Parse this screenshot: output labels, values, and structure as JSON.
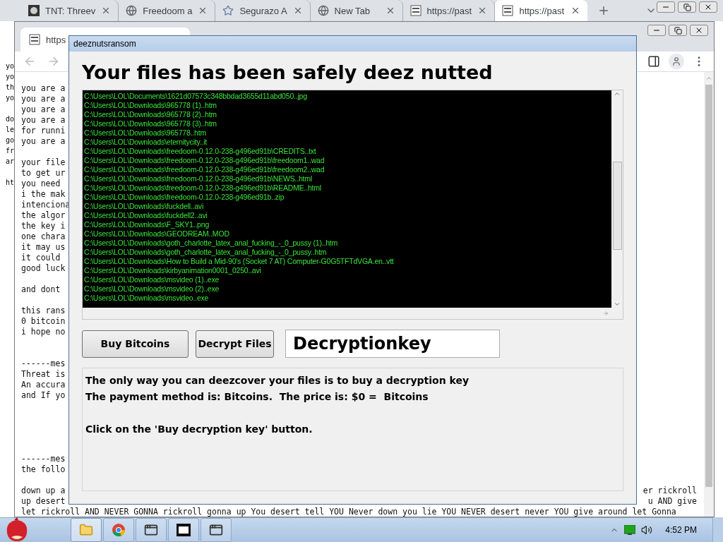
{
  "back_browser": {
    "tabs": [
      {
        "title": "TNT: Threev",
        "selected": false
      },
      {
        "title": "Freedoom a",
        "selected": false
      },
      {
        "title": "Segurazo A",
        "selected": false
      },
      {
        "title": "New Tab",
        "selected": false
      },
      {
        "title": "https://past",
        "selected": false
      },
      {
        "title": "https://past",
        "selected": true
      }
    ],
    "page_lines": [
      {
        "kind": "text",
        "text": "yo"
      },
      {
        "kind": "text",
        "text": "yo"
      },
      {
        "kind": "text",
        "text": "th"
      },
      {
        "kind": "text",
        "text": "yo"
      },
      {
        "kind": "blank"
      },
      {
        "kind": "text",
        "text": "do"
      },
      {
        "kind": "text",
        "text": "le"
      },
      {
        "kind": "text",
        "text": "go"
      },
      {
        "kind": "text",
        "text": "fr"
      },
      {
        "kind": "text",
        "text": "ar"
      },
      {
        "kind": "blank"
      },
      {
        "kind": "text",
        "text": "ht"
      }
    ]
  },
  "front_browser": {
    "tab": {
      "title": "https",
      "selected": true
    },
    "page_lines": [
      {
        "kind": "text",
        "text": "you are a"
      },
      {
        "kind": "text",
        "text": "you are a"
      },
      {
        "kind": "text",
        "text": "you are a"
      },
      {
        "kind": "text",
        "text": "you are a"
      },
      {
        "kind": "text",
        "text": "for runni"
      },
      {
        "kind": "text",
        "text": "you are a"
      },
      {
        "kind": "blank"
      },
      {
        "kind": "text",
        "text": "your file"
      },
      {
        "kind": "text",
        "text": "to get ur"
      },
      {
        "kind": "text",
        "text": "you need"
      },
      {
        "kind": "text",
        "text": "i the mak"
      },
      {
        "kind": "text",
        "text": "intenciona"
      },
      {
        "kind": "text",
        "text": "the algor"
      },
      {
        "kind": "text",
        "text": "the key i"
      },
      {
        "kind": "text",
        "text": "one chara"
      },
      {
        "kind": "text",
        "text": "it may us"
      },
      {
        "kind": "text",
        "text": "it could"
      },
      {
        "kind": "text",
        "text": "good luck"
      },
      {
        "kind": "blank"
      },
      {
        "kind": "text",
        "text": "and dont"
      },
      {
        "kind": "blank"
      },
      {
        "kind": "text",
        "text": "this rans"
      },
      {
        "kind": "text",
        "text": "0 bitcoin"
      },
      {
        "kind": "text",
        "text": "i hope no"
      },
      {
        "kind": "blank"
      },
      {
        "kind": "blank"
      },
      {
        "kind": "text",
        "text": "------mes"
      },
      {
        "kind": "text",
        "text": "Threat is"
      },
      {
        "kind": "text",
        "text": "An accura"
      },
      {
        "kind": "text",
        "text": "and If yo"
      },
      {
        "kind": "blank"
      },
      {
        "kind": "blank"
      },
      {
        "kind": "blank"
      },
      {
        "kind": "blank"
      },
      {
        "kind": "blank"
      },
      {
        "kind": "text",
        "text": "------mes"
      },
      {
        "kind": "text",
        "text": "the follo"
      },
      {
        "kind": "blank"
      },
      {
        "kind": "text",
        "text": "down up a",
        "tail": "er rickroll"
      },
      {
        "kind": "text",
        "text": "up desert",
        "tail": "u AND give"
      },
      {
        "kind": "text",
        "text": "let rickroll AND NEVER GONNA rickroll gonna up You desert tell YOU Never down you lie YOU NEVER desert never YOU give around let Gonna"
      }
    ]
  },
  "dialog": {
    "title": "deeznutsransom",
    "heading": "Your files has been safely deez nutted",
    "files": [
      "C:\\Users\\LOL\\Documents\\1621d07573c348bbdad3655d11abd050..jpg",
      "C:\\Users\\LOL\\Downloads\\965778 (1)..htm",
      "C:\\Users\\LOL\\Downloads\\965778 (2)..htm",
      "C:\\Users\\LOL\\Downloads\\965778 (3)..htm",
      "C:\\Users\\LOL\\Downloads\\965778..htm",
      "C:\\Users\\LOL\\Downloads\\eternitycity..it",
      "C:\\Users\\LOL\\Downloads\\freedoom-0.12.0-238-g496ed91b\\CREDITS..txt",
      "C:\\Users\\LOL\\Downloads\\freedoom-0.12.0-238-g496ed91b\\freedoom1..wad",
      "C:\\Users\\LOL\\Downloads\\freedoom-0.12.0-238-g496ed91b\\freedoom2..wad",
      "C:\\Users\\LOL\\Downloads\\freedoom-0.12.0-238-g496ed91b\\NEWS..html",
      "C:\\Users\\LOL\\Downloads\\freedoom-0.12.0-238-g496ed91b\\README..html",
      "C:\\Users\\LOL\\Downloads\\freedoom-0.12.0-238-g496ed91b..zip",
      "C:\\Users\\LOL\\Downloads\\fuckdell..avi",
      "C:\\Users\\LOL\\Downloads\\fuckdell2..avi",
      "C:\\Users\\LOL\\Downloads\\F_SKY1..png",
      "C:\\Users\\LOL\\Downloads\\GEODREAM..MOD",
      "C:\\Users\\LOL\\Downloads\\goth_charlotte_latex_anal_fucking_-_0_pussy (1)..htm",
      "C:\\Users\\LOL\\Downloads\\goth_charlotte_latex_anal_fucking_-_0_pussy..htm",
      "C:\\Users\\LOL\\Downloads\\How to Build a Mid-90's (Socket 7 AT) Computer-G0G5TFTdVGA.en..vtt",
      "C:\\Users\\LOL\\Downloads\\kirbyanimation0001_0250..avi",
      "C:\\Users\\LOL\\Downloads\\msvideo (1)..exe",
      "C:\\Users\\LOL\\Downloads\\msvideo (2)..exe",
      "C:\\Users\\LOL\\Downloads\\msvideo..exe"
    ],
    "buttons": [
      "Buy Bitcoins",
      "Decrypt Files"
    ],
    "key_field": {
      "value": "Decryptionkey"
    },
    "message": [
      {
        "kind": "text",
        "text": "The only way you can deezcover your files is to buy a decryption key"
      },
      {
        "kind": "text",
        "text": "The payment method is: Bitcoins.  The price is: $0 =  Bitcoins"
      },
      {
        "kind": "blank"
      },
      {
        "kind": "text",
        "text": "Click on the 'Buy decryption key' button."
      }
    ]
  },
  "taskbar": {
    "items": [
      {
        "kind": "explorer",
        "selected": true
      },
      {
        "kind": "chrome",
        "selected": false
      },
      {
        "kind": "window",
        "selected": false
      },
      {
        "kind": "archiver",
        "selected": false
      },
      {
        "kind": "window",
        "selected": false
      }
    ],
    "clock": "4:52 PM"
  }
}
